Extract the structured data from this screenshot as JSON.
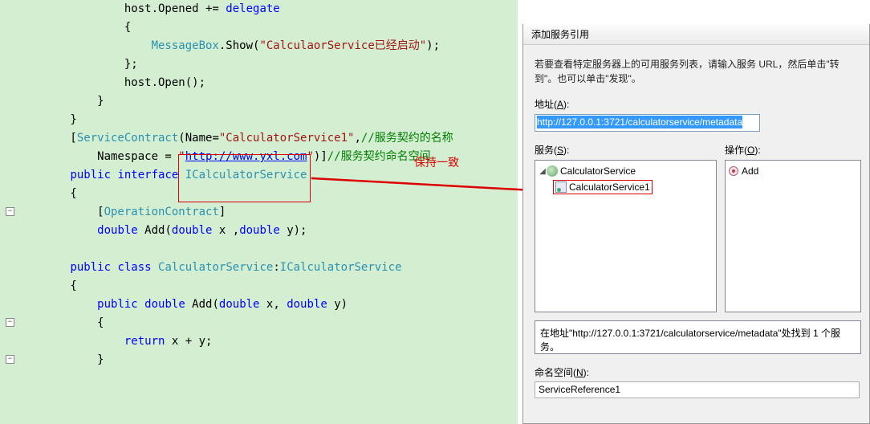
{
  "code": {
    "l1a": "                host.Opened += ",
    "l1b": "delegate",
    "l2": "                {",
    "l3a": "                    ",
    "l3b": "MessageBox",
    "l3c": ".Show(",
    "l3d": "\"CalculaorService已经启动\"",
    "l3e": ");",
    "l4": "                };",
    "l5": "                host.Open();",
    "l6": "            }",
    "l7": "        }",
    "l8": "",
    "l9a": "        [",
    "l9b": "ServiceContract",
    "l9c": "(Name=",
    "l9d": "\"CalculatorService1\"",
    "l9e": ",",
    "l9f": "//服务契约的名称",
    "l10a": "            Namespace = ",
    "l10b": "\"",
    "l10c": "http://www.yxl.com",
    "l10d": "\"",
    "l10e": ")]",
    "l10f": "//服务契约命名空间",
    "l11a": "        ",
    "l11b": "public",
    "l11c": " ",
    "l11d": "interface",
    "l11e": " ",
    "l11f": "ICalculatorService",
    "l12": "        {",
    "l13a": "            [",
    "l13b": "OperationContract",
    "l13c": "]",
    "l14a": "            ",
    "l14b": "double",
    "l14c": " Add(",
    "l14d": "double",
    "l14e": " x ,",
    "l14f": "double",
    "l14g": " y);",
    "l15": "",
    "l16a": "        ",
    "l16b": "public",
    "l16c": " ",
    "l16d": "class",
    "l16e": " ",
    "l16f": "CalculatorService",
    "l16g": ":",
    "l16h": "ICalculatorService",
    "l17": "        {",
    "l18a": "            ",
    "l18b": "public",
    "l18c": " ",
    "l18d": "double",
    "l18e": " Add(",
    "l18f": "double",
    "l18g": " x, ",
    "l18h": "double",
    "l18i": " y)",
    "l19": "            {",
    "l20a": "                ",
    "l20b": "return",
    "l20c": " x + y;",
    "l21": "            }"
  },
  "annotation": "保持一致",
  "dialog": {
    "title": "添加服务引用",
    "instruction": "若要查看特定服务器上的可用服务列表，请输入服务 URL，然后单击\"转到\"。也可以单击\"发现\"。",
    "address_label": "地址(A):",
    "address_value": "http://127.0.0.1:3721/calculatorservice/metadata",
    "services_label": "服务(S):",
    "operations_label": "操作(O):",
    "tree_root": "CalculatorService",
    "tree_child": "CalculatorService1",
    "op_add": "Add",
    "status": "在地址\"http://127.0.0.1:3721/calculatorservice/metadata\"处找到 1 个服务。",
    "ns_label": "命名空间(N):",
    "ns_value": "ServiceReference1"
  }
}
